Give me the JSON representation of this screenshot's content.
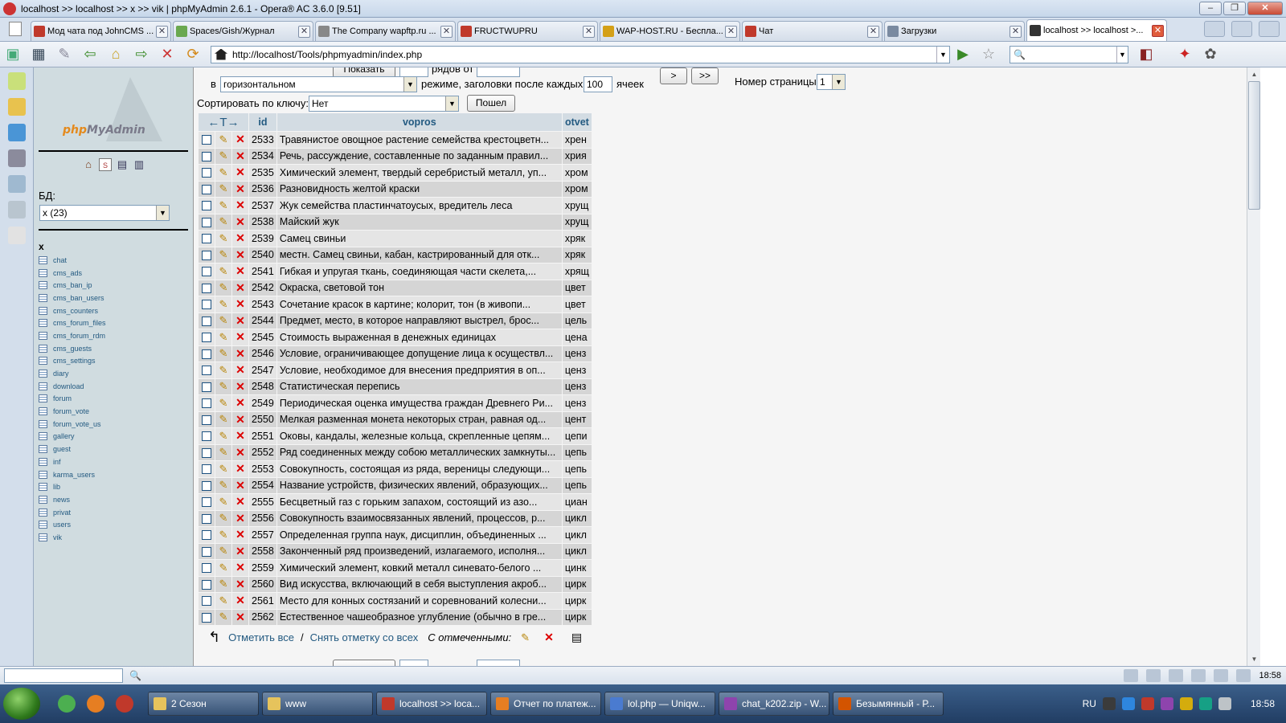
{
  "window": {
    "title": "localhost >> localhost >> x >> vik | phpMyAdmin 2.6.1 - Opera® AC 3.6.0 [9.51]",
    "min": "–",
    "max": "❐",
    "close": "✕"
  },
  "tabs": [
    {
      "label": "Мод чата под JohnCMS ...",
      "icon_color": "#c0392b"
    },
    {
      "label": "Spaces/Gish/Журнал",
      "icon_color": "#6aa84f"
    },
    {
      "label": "The Company wapftp.ru ...",
      "icon_color": "#888888"
    },
    {
      "label": "FRUCTWUPRU",
      "icon_color": "#c0392b"
    },
    {
      "label": "WAP-HOST.RU - Беспла...",
      "icon_color": "#d4a017"
    },
    {
      "label": "Чат",
      "icon_color": "#c0392b"
    },
    {
      "label": "Загрузки",
      "icon_color": "#7a8aa0"
    },
    {
      "label": "localhost >> localhost >...",
      "icon_color": "#333333",
      "active": true
    }
  ],
  "address": {
    "url": "http://localhost/Tools/phpmyadmin/index.php"
  },
  "pma_left": {
    "logo_left": "php",
    "logo_right": "MyAdmin",
    "bd_label": "БД:",
    "db_select": "x (23)",
    "db_name": "x",
    "tables": [
      "chat",
      "cms_ads",
      "cms_ban_ip",
      "cms_ban_users",
      "cms_counters",
      "cms_forum_files",
      "cms_forum_rdm",
      "cms_guests",
      "cms_settings",
      "diary",
      "download",
      "forum",
      "forum_vote",
      "forum_vote_us",
      "gallery",
      "guest",
      "inf",
      "karma_users",
      "lib",
      "news",
      "privat",
      "users",
      "vik"
    ]
  },
  "controls": {
    "mode_prefix": "в",
    "mode_value": "горизонтальном",
    "mode_suffix": "режиме, заголовки после каждых",
    "repeat_value": "100",
    "cells_label": "ячеек",
    "next_btn": ">",
    "last_btn": ">>",
    "page_label": "Номер страницы:",
    "page_value": "1",
    "sort_label": "Сортировать по ключу:",
    "sort_value": "Нет",
    "go_btn": "Пошел",
    "show_btn": "Показать",
    "rows_label": "рядов от"
  },
  "table": {
    "arrows": "←T→",
    "columns": [
      "id",
      "vopros",
      "otvet"
    ],
    "rows": [
      [
        "2533",
        "Травянистое овощное растение семейства крестоцветн...",
        "хрен"
      ],
      [
        "2534",
        "Речь, рассуждение, составленные по заданным правил...",
        "хрия"
      ],
      [
        "2535",
        "Химический элемент, твердый серебристый металл, уп...",
        "хром"
      ],
      [
        "2536",
        "Разновидность желтой краски",
        "хром"
      ],
      [
        "2537",
        "Жук семейства пластинчатоусых, вредитель леса",
        "хрущ"
      ],
      [
        "2538",
        "Майский жук",
        "хрущ"
      ],
      [
        "2539",
        "Самец свиньи",
        "хряк"
      ],
      [
        "2540",
        "местн. Самец свиньи, кабан, кастрированный для отк...",
        "хряк"
      ],
      [
        "2541",
        "Гибкая и упругая ткань, соединяющая части скелета,...",
        "хрящ"
      ],
      [
        "2542",
        "Окраска, световой тон",
        "цвет"
      ],
      [
        "2543",
        "Сочетание красок в картине; колорит, тон (в живопи...",
        "цвет"
      ],
      [
        "2544",
        "Предмет, место, в которое направляют выстрел, брос...",
        "цель"
      ],
      [
        "2545",
        "Стоимость выраженная в денежных единицах",
        "цена"
      ],
      [
        "2546",
        "Условие, ограничивающее допущение лица к осуществл...",
        "ценз"
      ],
      [
        "2547",
        "Условие, необходимое для внесения предприятия в оп...",
        "ценз"
      ],
      [
        "2548",
        "Статистическая перепись",
        "ценз"
      ],
      [
        "2549",
        "Периодическая оценка имущества граждан Древнего Ри...",
        "ценз"
      ],
      [
        "2550",
        "Мелкая разменная монета некоторых стран, равная од...",
        "цент"
      ],
      [
        "2551",
        "Оковы, кандалы, железные кольца, скрепленные цепям...",
        "цепи"
      ],
      [
        "2552",
        "Ряд соединенных между собою металлических замкнуты...",
        "цепь"
      ],
      [
        "2553",
        "Совокупность, состоящая из ряда, вереницы следующи...",
        "цепь"
      ],
      [
        "2554",
        "Название устройств, физических явлений, образующих...",
        "цепь"
      ],
      [
        "2555",
        "Бесцветный газ с горьким запахом, состоящий из азо...",
        "циан"
      ],
      [
        "2556",
        "Совокупность взаимосвязанных явлений, процессов, р...",
        "цикл"
      ],
      [
        "2557",
        "Определенная группа наук, дисциплин, объединенных ...",
        "цикл"
      ],
      [
        "2558",
        "Законченный ряд произведений, излагаемого, исполня...",
        "цикл"
      ],
      [
        "2559",
        "Химический элемент, ковкий металл синевато-белого ...",
        "цинк"
      ],
      [
        "2560",
        "Вид искусства, включающий в себя выступления акроб...",
        "цирк"
      ],
      [
        "2561",
        "Место для конных состязаний и соревнований колесни...",
        "цирк"
      ],
      [
        "2562",
        "Естественное чашеобразное углубление (обычно в гре...",
        "цирк"
      ]
    ]
  },
  "bulk": {
    "check_all": "Отметить все",
    "separator": "/",
    "uncheck_all": "Снять отметку со всех",
    "with_selected": "С отмеченными:"
  },
  "status": {
    "time": "18:58"
  },
  "taskbar": {
    "items": [
      {
        "label": "2 Сезон",
        "color": "#e6c35c"
      },
      {
        "label": "www",
        "color": "#e6c35c"
      },
      {
        "label": "localhost >> loca...",
        "color": "#c0392b"
      },
      {
        "label": "Отчет по платеж...",
        "color": "#e67e22"
      },
      {
        "label": "lol.php — Uniqw...",
        "color": "#4a7bd0"
      },
      {
        "label": "chat_k202.zip - W...",
        "color": "#8e44ad"
      },
      {
        "label": "Безымянный - Р...",
        "color": "#d35400"
      }
    ],
    "lang": "RU",
    "clock": "18:58"
  }
}
